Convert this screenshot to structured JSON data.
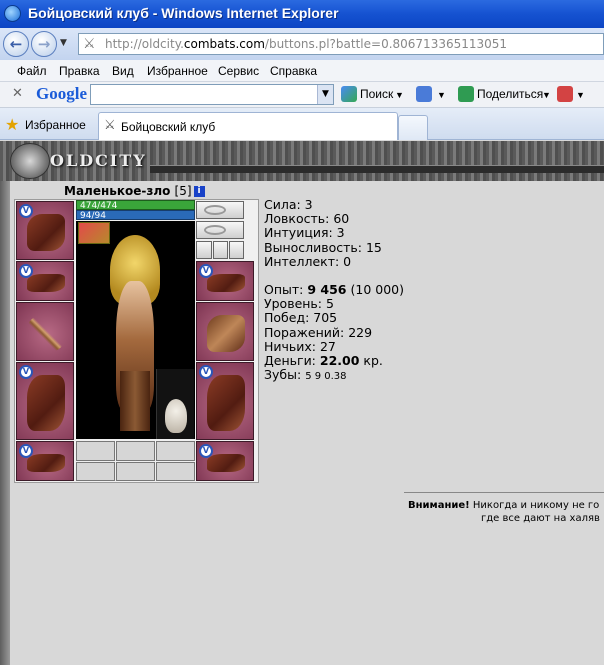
{
  "window": {
    "title": "Бойцовский клуб - Windows Internet Explorer"
  },
  "address": {
    "prefix": "http://oldcity.",
    "domain": "combats.com",
    "path": "/buttons.pl?battle=0.806713365113051"
  },
  "menu": [
    "Файл",
    "Правка",
    "Вид",
    "Избранное",
    "Сервис",
    "Справка"
  ],
  "google_toolbar": {
    "logo": "Google",
    "search_label": "Поиск",
    "share_label": "Поделиться"
  },
  "favorites": {
    "label": "Избранное",
    "tab_title": "Бойцовский клуб"
  },
  "game": {
    "logo": "OLDCITY"
  },
  "character": {
    "name": "Маленькое-зло",
    "level": "[5]",
    "hp": "474/474",
    "mana": "94/94"
  },
  "stats": {
    "strength": "Сила: 3",
    "agility": "Ловкость: 60",
    "intuition": "Интуиция: 3",
    "endurance": "Выносливость: 15",
    "intellect": "Интеллект: 0",
    "experience_label": "Опыт: ",
    "experience_value": "9 456",
    "experience_next": " (10 000)",
    "level": "Уровень: 5",
    "wins": "Побед: 705",
    "losses": "Поражений: 229",
    "draws": "Ничьих: 27",
    "money_label": "Деньги: ",
    "money_value": "22.00",
    "money_unit": " кр.",
    "teeth_label": "Зубы: ",
    "teeth_values": "5  9  0.38"
  },
  "notice": {
    "bold": "Внимание!",
    "text": " Никогда и никому не го",
    "line2": "где все дают на халяв"
  }
}
